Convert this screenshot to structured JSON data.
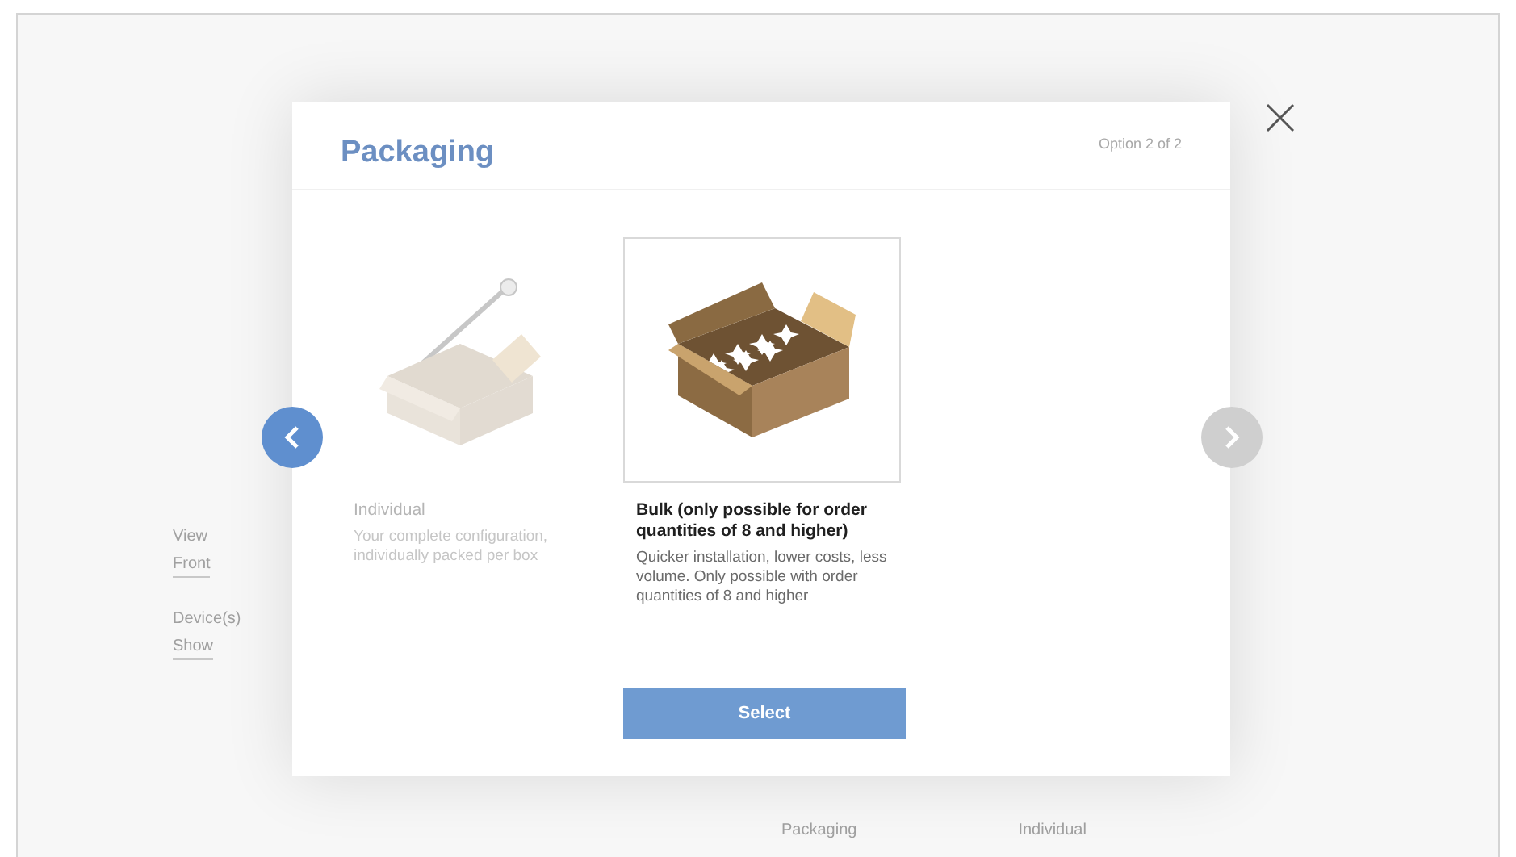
{
  "background": {
    "view": {
      "label": "View",
      "options": [
        "Front"
      ]
    },
    "devices": {
      "label": "Device(s)",
      "options": [
        "Show"
      ]
    },
    "summary": [
      "Packaging",
      "Individual"
    ]
  },
  "modal": {
    "title": "Packaging",
    "counter": "Option 2 of 2",
    "options": [
      {
        "kind": "individual",
        "title": "Individual",
        "description": "Your complete configuration, individually packed per box",
        "selected": false
      },
      {
        "kind": "bulk",
        "title": "Bulk (only possible for order quantities of 8 and higher)",
        "description": "Quicker installation, lower costs, less volume. Only possible with order quantities of 8 and higher",
        "selected": true
      }
    ],
    "button": "Select",
    "prev_disabled": false,
    "next_disabled": true
  }
}
